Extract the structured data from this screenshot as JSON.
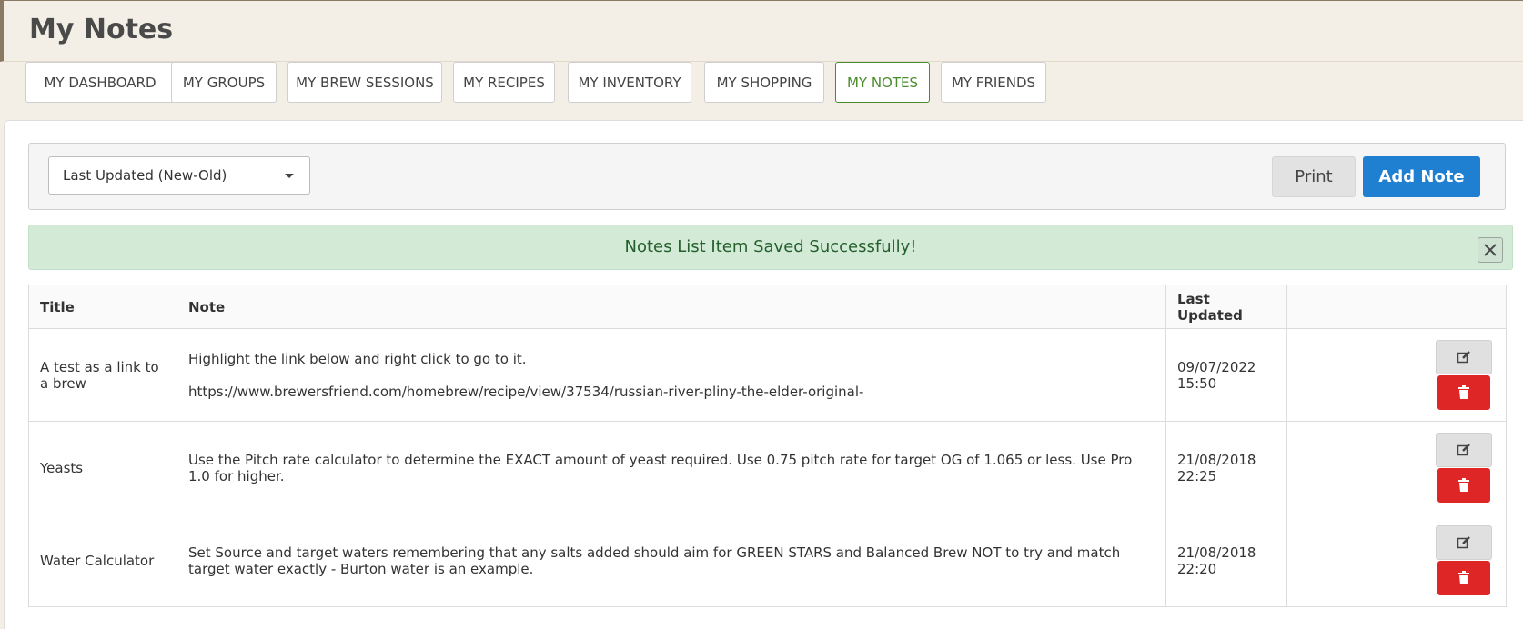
{
  "page": {
    "title": "My Notes"
  },
  "nav": {
    "tabs": [
      {
        "label": "MY DASHBOARD"
      },
      {
        "label": "MY GROUPS"
      },
      {
        "label": "MY BREW SESSIONS"
      },
      {
        "label": "MY RECIPES"
      },
      {
        "label": "MY INVENTORY"
      },
      {
        "label": "MY SHOPPING"
      },
      {
        "label": "MY NOTES",
        "active": true
      },
      {
        "label": "MY FRIENDS"
      }
    ]
  },
  "toolbar": {
    "sort_value": "Last Updated (New-Old)",
    "print_label": "Print",
    "add_label": "Add Note"
  },
  "alert": {
    "message": "Notes List Item Saved Successfully!",
    "close_icon": "close-icon"
  },
  "table": {
    "headers": [
      "Title",
      "Note",
      "Last Updated",
      ""
    ],
    "rows": [
      {
        "title": "A test as a link to a brew",
        "note_lines": [
          "Highlight the link below and right click to go to it.",
          "https://www.brewersfriend.com/homebrew/recipe/view/37534/russian-river-pliny-the-elder-original-"
        ],
        "last_updated": "09/07/2022 15:50"
      },
      {
        "title": "Yeasts",
        "note_lines": [
          "Use the Pitch rate calculator to determine the EXACT amount of yeast required. Use 0.75 pitch rate for target OG of 1.065 or less. Use Pro 1.0 for higher."
        ],
        "last_updated": "21/08/2018 22:25"
      },
      {
        "title": "Water Calculator",
        "note_lines": [
          "Set Source and target waters remembering that any salts added should aim for GREEN STARS and Balanced Brew NOT to try and match target water exactly - Burton water is an example."
        ],
        "last_updated": "21/08/2018 22:20"
      }
    ],
    "row_actions": {
      "edit_icon": "edit-icon",
      "delete_icon": "trash-icon"
    }
  },
  "colors": {
    "background": "#f3efe7",
    "active_tab": "#4a8c2a",
    "primary_button": "#1f7fd1",
    "alert_bg": "#d3ead7",
    "alert_text": "#255f2e",
    "delete_button": "#df2626"
  }
}
